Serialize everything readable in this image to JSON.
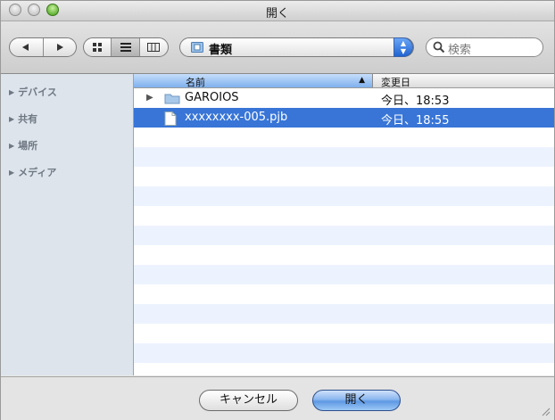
{
  "window": {
    "title": "開く"
  },
  "toolbar": {
    "location": "書類",
    "search_placeholder": "検索"
  },
  "sidebar": {
    "items": [
      {
        "label": "デバイス"
      },
      {
        "label": "共有"
      },
      {
        "label": "場所"
      },
      {
        "label": "メディア"
      }
    ]
  },
  "browser": {
    "columns": {
      "name": "名前",
      "date": "変更日"
    },
    "rows": [
      {
        "name": "GAROIOS",
        "date": "今日、18:53",
        "kind": "folder",
        "selected": false
      },
      {
        "name": "xxxxxxxx-005.pjb",
        "date": "今日、18:55",
        "kind": "document",
        "selected": true
      }
    ]
  },
  "buttons": {
    "cancel": "キャンセル",
    "open": "開く"
  },
  "colors": {
    "selection": "#3875d7",
    "stripe": "#edf3fe",
    "sidebar": "#dde4ec"
  }
}
